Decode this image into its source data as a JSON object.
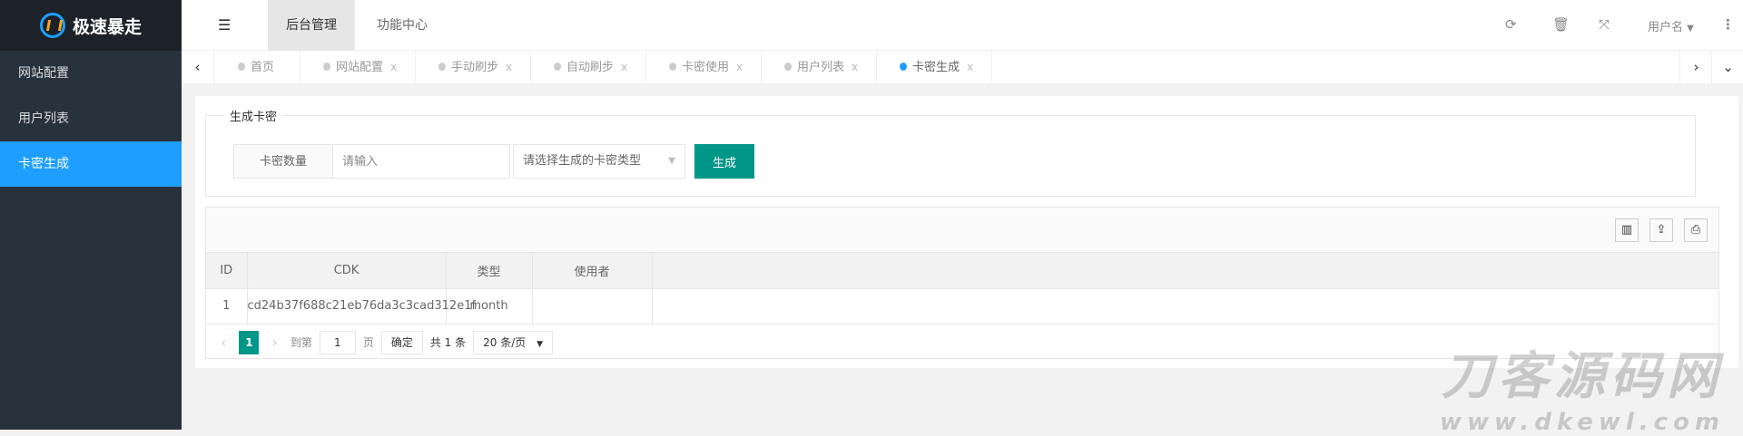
{
  "app": {
    "name": "极速暴走",
    "accent": "#1e9fff",
    "primary": "#009688"
  },
  "sidebar": {
    "items": [
      {
        "label": "网站配置"
      },
      {
        "label": "用户列表"
      },
      {
        "label": "卡密生成",
        "active": true
      }
    ]
  },
  "header": {
    "tabs": [
      {
        "label": "后台管理",
        "active": true
      },
      {
        "label": "功能中心"
      }
    ],
    "user": "用户名",
    "icons": [
      "refresh-icon",
      "trash-icon",
      "fullscreen-icon",
      "more-icon"
    ]
  },
  "tabs": [
    {
      "label": "首页",
      "closable": false
    },
    {
      "label": "网站配置"
    },
    {
      "label": "手动刷步"
    },
    {
      "label": "自动刷步"
    },
    {
      "label": "卡密使用"
    },
    {
      "label": "用户列表"
    },
    {
      "label": "卡密生成",
      "active": true
    }
  ],
  "tab_close": "x",
  "form": {
    "legend": "生成卡密",
    "qty_label": "卡密数量",
    "qty_placeholder": "请输入",
    "type_placeholder": "请选择生成的卡密类型",
    "submit": "生成"
  },
  "table": {
    "columns": [
      "ID",
      "CDK",
      "类型",
      "使用者",
      ""
    ],
    "rows": [
      [
        "1",
        "cd24b37f688c21eb76da3c3cad312e1f",
        "month",
        ""
      ]
    ]
  },
  "pager": {
    "current": "1",
    "goto_label": "到第",
    "goto_value": "1",
    "page_unit": "页",
    "confirm": "确定",
    "total": "共 1 条",
    "page_size": "20 条/页"
  },
  "watermark": {
    "line1": "刀客源码网",
    "line2": "www.dkewl.com"
  }
}
